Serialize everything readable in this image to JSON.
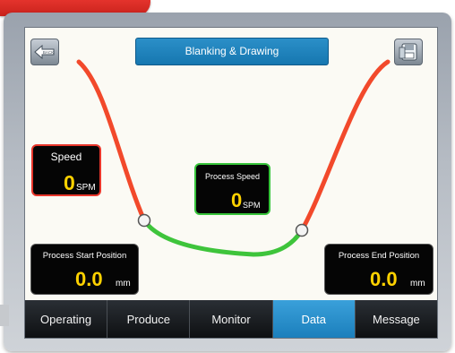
{
  "screen": {
    "title": "Blanking & Drawing",
    "back_label": "BACK"
  },
  "readouts": {
    "speed": {
      "label": "Speed",
      "value": "0",
      "unit": "SPM"
    },
    "process_speed": {
      "label": "Process Speed",
      "value": "0",
      "unit": "SPM"
    },
    "process_start": {
      "label": "Process Start Position",
      "value": "0.0",
      "unit": "mm"
    },
    "process_end": {
      "label": "Process End Position",
      "value": "0.0",
      "unit": "mm"
    }
  },
  "tabs": [
    {
      "label": "Operating",
      "active": false
    },
    {
      "label": "Produce",
      "active": false
    },
    {
      "label": "Monitor",
      "active": false
    },
    {
      "label": "Data",
      "active": true
    },
    {
      "label": "Message",
      "active": false
    }
  ],
  "icons": {
    "back": "back-arrow-icon",
    "save": "save-disk-icon"
  },
  "colors": {
    "title_bar": "#1f84bf",
    "curve_idle": "#f2492b",
    "curve_process": "#3ec43b",
    "value_text": "#ffd200",
    "active_tab": "#2b92cf"
  }
}
